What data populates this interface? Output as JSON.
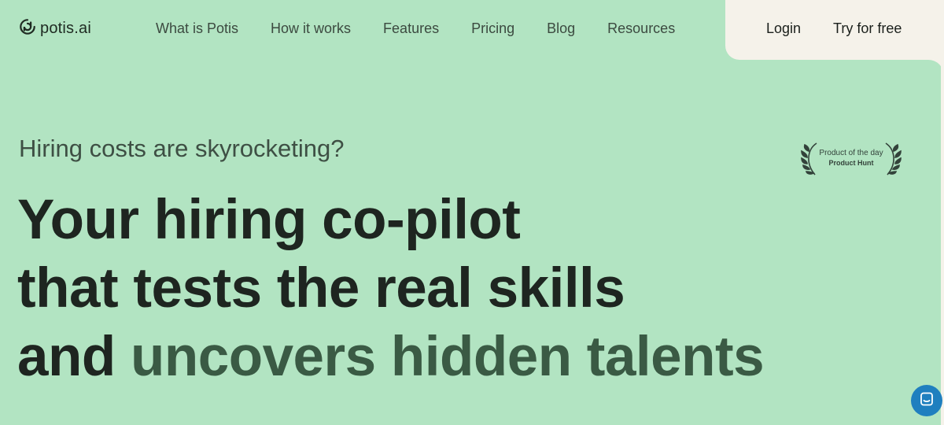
{
  "brand": {
    "name": "potis.ai",
    "logo_icon": "potis-logo-icon"
  },
  "nav": {
    "items": [
      {
        "label": "What is Potis"
      },
      {
        "label": "How it works"
      },
      {
        "label": "Features"
      },
      {
        "label": "Pricing"
      },
      {
        "label": "Blog"
      },
      {
        "label": "Resources"
      }
    ]
  },
  "auth": {
    "login_label": "Login",
    "try_label": "Try for free"
  },
  "hero": {
    "subtitle": "Hiring costs are skyrocketing?",
    "headline_line1": "Your hiring co-pilot",
    "headline_line2": "that tests the real skills",
    "headline_line3_plain": "and",
    "headline_line3_accent": "uncovers hidden talents"
  },
  "award": {
    "line1": "Product of the day",
    "line2": "Product Hunt",
    "icon": "laurel-icon"
  },
  "chat": {
    "icon": "chat-icon"
  },
  "colors": {
    "background": "#b2e4c2",
    "panel": "#f5f2ea",
    "headline": "#1e2520",
    "accent": "#3a5a44",
    "chat": "#1f7fbf"
  }
}
